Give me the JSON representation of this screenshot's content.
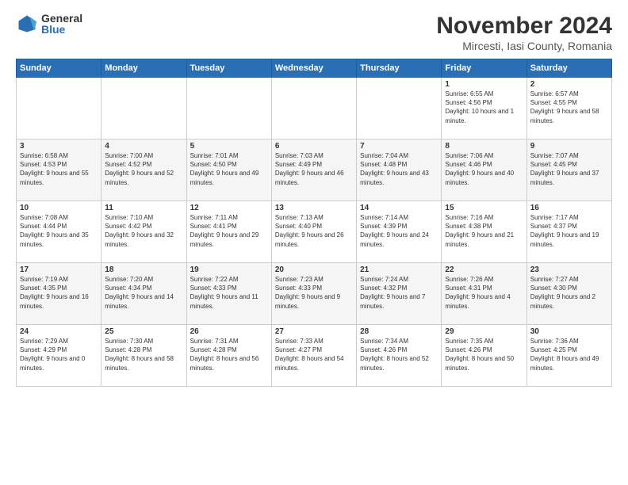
{
  "logo": {
    "general": "General",
    "blue": "Blue"
  },
  "title": "November 2024",
  "location": "Mircesti, Iasi County, Romania",
  "days_header": [
    "Sunday",
    "Monday",
    "Tuesday",
    "Wednesday",
    "Thursday",
    "Friday",
    "Saturday"
  ],
  "weeks": [
    {
      "row_bg": "light",
      "days": [
        {
          "num": "",
          "info": ""
        },
        {
          "num": "",
          "info": ""
        },
        {
          "num": "",
          "info": ""
        },
        {
          "num": "",
          "info": ""
        },
        {
          "num": "",
          "info": ""
        },
        {
          "num": "1",
          "info": "Sunrise: 6:55 AM\nSunset: 4:56 PM\nDaylight: 10 hours and 1 minute."
        },
        {
          "num": "2",
          "info": "Sunrise: 6:57 AM\nSunset: 4:55 PM\nDaylight: 9 hours and 58 minutes."
        }
      ]
    },
    {
      "row_bg": "medium",
      "days": [
        {
          "num": "3",
          "info": "Sunrise: 6:58 AM\nSunset: 4:53 PM\nDaylight: 9 hours and 55 minutes."
        },
        {
          "num": "4",
          "info": "Sunrise: 7:00 AM\nSunset: 4:52 PM\nDaylight: 9 hours and 52 minutes."
        },
        {
          "num": "5",
          "info": "Sunrise: 7:01 AM\nSunset: 4:50 PM\nDaylight: 9 hours and 49 minutes."
        },
        {
          "num": "6",
          "info": "Sunrise: 7:03 AM\nSunset: 4:49 PM\nDaylight: 9 hours and 46 minutes."
        },
        {
          "num": "7",
          "info": "Sunrise: 7:04 AM\nSunset: 4:48 PM\nDaylight: 9 hours and 43 minutes."
        },
        {
          "num": "8",
          "info": "Sunrise: 7:06 AM\nSunset: 4:46 PM\nDaylight: 9 hours and 40 minutes."
        },
        {
          "num": "9",
          "info": "Sunrise: 7:07 AM\nSunset: 4:45 PM\nDaylight: 9 hours and 37 minutes."
        }
      ]
    },
    {
      "row_bg": "light",
      "days": [
        {
          "num": "10",
          "info": "Sunrise: 7:08 AM\nSunset: 4:44 PM\nDaylight: 9 hours and 35 minutes."
        },
        {
          "num": "11",
          "info": "Sunrise: 7:10 AM\nSunset: 4:42 PM\nDaylight: 9 hours and 32 minutes."
        },
        {
          "num": "12",
          "info": "Sunrise: 7:11 AM\nSunset: 4:41 PM\nDaylight: 9 hours and 29 minutes."
        },
        {
          "num": "13",
          "info": "Sunrise: 7:13 AM\nSunset: 4:40 PM\nDaylight: 9 hours and 26 minutes."
        },
        {
          "num": "14",
          "info": "Sunrise: 7:14 AM\nSunset: 4:39 PM\nDaylight: 9 hours and 24 minutes."
        },
        {
          "num": "15",
          "info": "Sunrise: 7:16 AM\nSunset: 4:38 PM\nDaylight: 9 hours and 21 minutes."
        },
        {
          "num": "16",
          "info": "Sunrise: 7:17 AM\nSunset: 4:37 PM\nDaylight: 9 hours and 19 minutes."
        }
      ]
    },
    {
      "row_bg": "medium",
      "days": [
        {
          "num": "17",
          "info": "Sunrise: 7:19 AM\nSunset: 4:35 PM\nDaylight: 9 hours and 16 minutes."
        },
        {
          "num": "18",
          "info": "Sunrise: 7:20 AM\nSunset: 4:34 PM\nDaylight: 9 hours and 14 minutes."
        },
        {
          "num": "19",
          "info": "Sunrise: 7:22 AM\nSunset: 4:33 PM\nDaylight: 9 hours and 11 minutes."
        },
        {
          "num": "20",
          "info": "Sunrise: 7:23 AM\nSunset: 4:33 PM\nDaylight: 9 hours and 9 minutes."
        },
        {
          "num": "21",
          "info": "Sunrise: 7:24 AM\nSunset: 4:32 PM\nDaylight: 9 hours and 7 minutes."
        },
        {
          "num": "22",
          "info": "Sunrise: 7:26 AM\nSunset: 4:31 PM\nDaylight: 9 hours and 4 minutes."
        },
        {
          "num": "23",
          "info": "Sunrise: 7:27 AM\nSunset: 4:30 PM\nDaylight: 9 hours and 2 minutes."
        }
      ]
    },
    {
      "row_bg": "light",
      "days": [
        {
          "num": "24",
          "info": "Sunrise: 7:29 AM\nSunset: 4:29 PM\nDaylight: 9 hours and 0 minutes."
        },
        {
          "num": "25",
          "info": "Sunrise: 7:30 AM\nSunset: 4:28 PM\nDaylight: 8 hours and 58 minutes."
        },
        {
          "num": "26",
          "info": "Sunrise: 7:31 AM\nSunset: 4:28 PM\nDaylight: 8 hours and 56 minutes."
        },
        {
          "num": "27",
          "info": "Sunrise: 7:33 AM\nSunset: 4:27 PM\nDaylight: 8 hours and 54 minutes."
        },
        {
          "num": "28",
          "info": "Sunrise: 7:34 AM\nSunset: 4:26 PM\nDaylight: 8 hours and 52 minutes."
        },
        {
          "num": "29",
          "info": "Sunrise: 7:35 AM\nSunset: 4:26 PM\nDaylight: 8 hours and 50 minutes."
        },
        {
          "num": "30",
          "info": "Sunrise: 7:36 AM\nSunset: 4:25 PM\nDaylight: 8 hours and 49 minutes."
        }
      ]
    }
  ]
}
